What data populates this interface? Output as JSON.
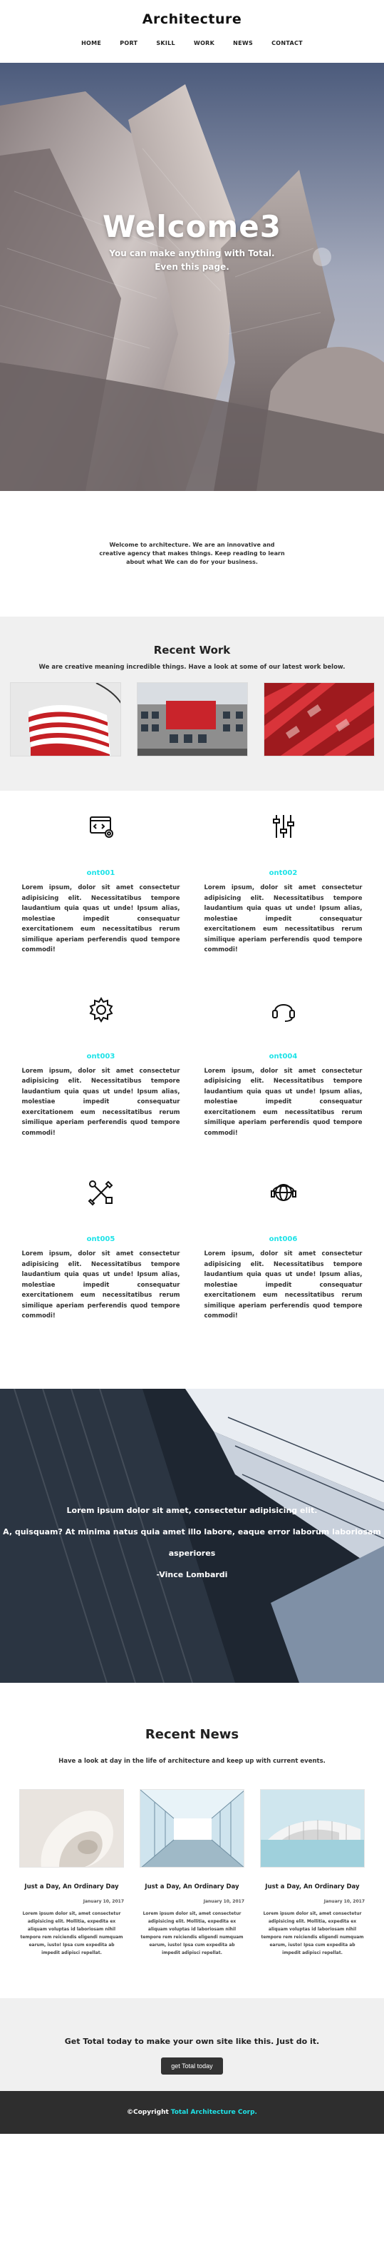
{
  "header": {
    "brand": "Architecture",
    "nav": [
      "HOME",
      "PORT",
      "SKILL",
      "WORK",
      "NEWS",
      "CONTACT"
    ]
  },
  "hero": {
    "title": "Welcome3",
    "subtitle_line1": "You can make anything with Total.",
    "subtitle_line2": "Even this page."
  },
  "intro": {
    "text": "Welcome to architecture. We are an innovative and creative agency that makes things. Keep reading to learn about what We can do for your business."
  },
  "recent_work": {
    "title": "Recent Work",
    "subtitle": "We are creative meaning incredible things. Have a look at some of our latest work below."
  },
  "services": [
    {
      "icon": "code-settings-icon",
      "title": "ont001",
      "text": "Lorem ipsum, dolor sit amet consectetur adipisicing elit. Necessitatibus tempore laudantium quia quas ut unde! Ipsum alias, molestiae impedit consequatur exercitationem eum necessitatibus rerum similique aperiam perferendis quod tempore commodi!"
    },
    {
      "icon": "sliders-icon",
      "title": "ont002",
      "text": "Lorem ipsum, dolor sit amet consectetur adipisicing elit. Necessitatibus tempore laudantium quia quas ut unde! Ipsum alias, molestiae impedit consequatur exercitationem eum necessitatibus rerum similique aperiam perferendis quod tempore commodi!"
    },
    {
      "icon": "gear-icon",
      "title": "ont003",
      "text": "Lorem ipsum, dolor sit amet consectetur adipisicing elit. Necessitatibus tempore laudantium quia quas ut unde! Ipsum alias, molestiae impedit consequatur exercitationem eum necessitatibus rerum similique aperiam perferendis quod tempore commodi!"
    },
    {
      "icon": "headset-icon",
      "title": "ont004",
      "text": "Lorem ipsum, dolor sit amet consectetur adipisicing elit. Necessitatibus tempore laudantium quia quas ut unde! Ipsum alias, molestiae impedit consequatur exercitationem eum necessitatibus rerum similique aperiam perferendis quod tempore commodi!"
    },
    {
      "icon": "tools-icon",
      "title": "ont005",
      "text": "Lorem ipsum, dolor sit amet consectetur adipisicing elit. Necessitatibus tempore laudantium quia quas ut unde! Ipsum alias, molestiae impedit consequatur exercitationem eum necessitatibus rerum similique aperiam perferendis quod tempore commodi!"
    },
    {
      "icon": "support-globe-icon",
      "title": "ont006",
      "text": "Lorem ipsum, dolor sit amet consectetur adipisicing elit. Necessitatibus tempore laudantium quia quas ut unde! Ipsum alias, molestiae impedit consequatur exercitationem eum necessitatibus rerum similique aperiam perferendis quod tempore commodi!"
    }
  ],
  "quote": {
    "line1": "Lorem ipsum dolor sit amet, consectetur adipisicing elit.",
    "line2": "A, quisquam? At minima natus quia amet illo labore, eaque error laborum laboriosam",
    "line3": "asperiores",
    "author": "-Vince Lombardi"
  },
  "news": {
    "title": "Recent News",
    "subtitle": "Have a look at day in the life of architecture and keep up with current events.",
    "items": [
      {
        "title": "Just a Day, An Ordinary Day",
        "date": "January 10, 2017",
        "text": "Lorem ipsum dolor sit, amet consectetur adipisicing elit. Mollitia, expedita ex aliquam voluptas id laboriosam nihil tempore rem reiciendis eligendi numquam earum, iusto! Ipsa cum expedita ab impedit adipisci repellat."
      },
      {
        "title": "Just a Day, An Ordinary Day",
        "date": "January 10, 2017",
        "text": "Lorem ipsum dolor sit, amet consectetur adipisicing elit. Mollitia, expedita ex aliquam voluptas id laboriosam nihil tempore rem reiciendis eligendi numquam earum, iusto! Ipsa cum expedita ab impedit adipisci repellat."
      },
      {
        "title": "Just a Day, An Ordinary Day",
        "date": "January 10, 2017",
        "text": "Lorem ipsum dolor sit, amet consectetur adipisicing elit. Mollitia, expedita ex aliquam voluptas id laboriosam nihil tempore rem reiciendis eligendi numquam earum, iusto! Ipsa cum expedita ab impedit adipisci repellat."
      }
    ]
  },
  "cta": {
    "text": "Get Total today to make your own site like this. Just do it.",
    "button": "get Total today"
  },
  "footer": {
    "copyright": "©Copyright",
    "company": "Total Architecture Corp."
  },
  "colors": {
    "accent": "#1ee3e8",
    "footer_bg": "#2e2e2e",
    "section_bg": "#f0f0f0"
  }
}
